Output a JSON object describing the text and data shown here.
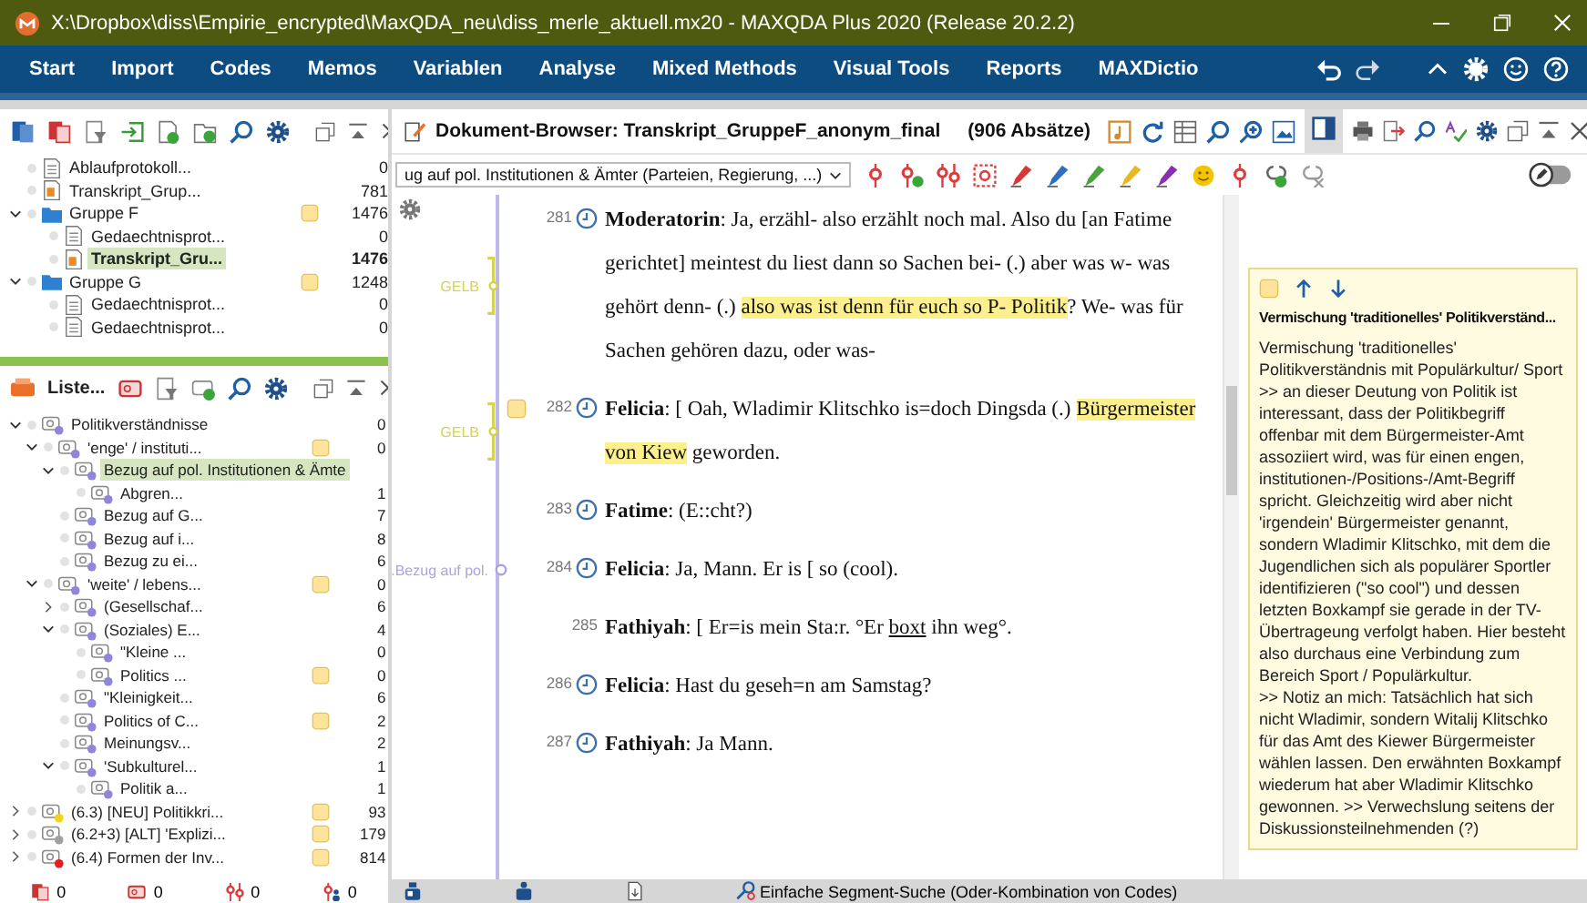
{
  "window": {
    "title": "X:\\Dropbox\\diss\\Empirie_encrypted\\MaxQDA_neu\\diss_merle_aktuell.mx20 - MAXQDA Plus 2020 (Release 20.2.2)"
  },
  "menu": [
    {
      "label": "Start"
    },
    {
      "label": "Import"
    },
    {
      "label": "Codes"
    },
    {
      "label": "Memos"
    },
    {
      "label": "Variablen"
    },
    {
      "label": "Analyse"
    },
    {
      "label": "Mixed Methods"
    },
    {
      "label": "Visual Tools"
    },
    {
      "label": "Reports"
    },
    {
      "label": "MAXDictio"
    }
  ],
  "documents": {
    "items": [
      {
        "kind": "text",
        "label": "Ablaufprotokoll...",
        "count": "0",
        "memo": false,
        "selected": false
      },
      {
        "kind": "transcript",
        "label": "Transkript_Grup...",
        "count": "781",
        "memo": false,
        "selected": false
      },
      {
        "kind": "group",
        "label": "Gruppe F",
        "count": "1476",
        "memo": true,
        "selected": false,
        "expanded": true,
        "children": [
          {
            "kind": "text",
            "label": "Gedaechtnisprot...",
            "count": "0",
            "memo": false,
            "selected": false
          },
          {
            "kind": "transcript",
            "label": "Transkript_Gru...",
            "count": "1476",
            "memo": false,
            "selected": true
          }
        ]
      },
      {
        "kind": "group",
        "label": "Gruppe G",
        "count": "1248",
        "memo": true,
        "selected": false,
        "expanded": true,
        "children": [
          {
            "kind": "text",
            "label": "Gedaechtnisprot...",
            "count": "0",
            "memo": false,
            "selected": false
          },
          {
            "kind": "text",
            "label": "Gedaechtnisprot...",
            "count": "0",
            "memo": false,
            "selected": false
          }
        ]
      }
    ]
  },
  "codes": {
    "title": "Liste...",
    "items": [
      {
        "label": "Politikverständnisse",
        "count": "0",
        "memo": false,
        "color": "#8f86d8",
        "selected": false,
        "expanded": true,
        "children": [
          {
            "label": "'enge' / instituti...",
            "count": "0",
            "memo": true,
            "color": "#8f86d8",
            "selected": false,
            "expanded": true,
            "children": [
              {
                "label": "Bezug auf pol. Institutionen & Ämte",
                "memo": false,
                "color": "#8f86d8",
                "selected": true,
                "expanded": true,
                "children": [
                  {
                    "label": "Abgren...",
                    "count": "1",
                    "memo": false,
                    "color": "#8f86d8",
                    "selected": false
                  }
                ]
              },
              {
                "label": "Bezug auf G...",
                "count": "7",
                "memo": false,
                "color": "#8f86d8",
                "selected": false
              },
              {
                "label": "Bezug auf i...",
                "count": "8",
                "memo": false,
                "color": "#8f86d8",
                "selected": false
              },
              {
                "label": "Bezug zu ei...",
                "count": "6",
                "memo": false,
                "color": "#8f86d8",
                "selected": false
              }
            ]
          },
          {
            "label": "'weite' / lebens...",
            "count": "0",
            "memo": true,
            "color": "#8f86d8",
            "selected": false,
            "expanded": true,
            "children": [
              {
                "label": "(Gesellschaf...",
                "count": "6",
                "memo": false,
                "color": "#8f86d8",
                "selected": false,
                "expanded": false
              },
              {
                "label": "(Soziales) E...",
                "count": "4",
                "memo": false,
                "color": "#8f86d8",
                "selected": false,
                "expanded": true,
                "children": [
                  {
                    "label": "\"Kleine ...",
                    "count": "0",
                    "memo": false,
                    "color": "#8f86d8",
                    "selected": false
                  },
                  {
                    "label": "Politics ...",
                    "count": "0",
                    "memo": true,
                    "color": "#8f86d8",
                    "selected": false
                  }
                ]
              },
              {
                "label": "\"Kleinigkeit...",
                "count": "6",
                "memo": false,
                "color": "#8f86d8",
                "selected": false
              },
              {
                "label": "Politics of C...",
                "count": "2",
                "memo": true,
                "color": "#8f86d8",
                "selected": false
              },
              {
                "label": "Meinungsv...",
                "count": "2",
                "memo": false,
                "color": "#8f86d8",
                "selected": false
              },
              {
                "label": "'Subkulturel...",
                "count": "1",
                "memo": false,
                "color": "#8f86d8",
                "selected": false,
                "expanded": true,
                "children": [
                  {
                    "label": "Politik a...",
                    "count": "1",
                    "memo": false,
                    "color": "#8f86d8",
                    "selected": false
                  }
                ]
              }
            ]
          }
        ]
      },
      {
        "label": "(6.3) [NEU] Politikkri...",
        "count": "93",
        "memo": true,
        "color": "#f2d21b",
        "selected": false,
        "expanded": false
      },
      {
        "label": "(6.2+3) [ALT] 'Explizi...",
        "count": "179",
        "memo": true,
        "color": "#a0a0a0",
        "selected": false,
        "expanded": false
      },
      {
        "label": "(6.4) Formen der Inv...",
        "count": "814",
        "memo": true,
        "color": "#e02020",
        "selected": false,
        "expanded": false
      }
    ]
  },
  "document_browser": {
    "title": "Dokument-Browser: Transkript_GruppeF_anonym_final",
    "paragraph_count": "(906 Absätze)",
    "code_selector": "ug auf pol. Institutionen & Ämter (Parteien, Regierung, ...)",
    "paragraphs": [
      {
        "number": "281",
        "clock": true,
        "memo": false,
        "code_marks": [
          {
            "kind": "bracket",
            "label": "GELB",
            "color": "#d4d44c"
          }
        ],
        "segments": [
          {
            "kind": "speaker",
            "text": "Moderatorin"
          },
          {
            "kind": "plain",
            "text": ": Ja, erzähl- also erzählt noch mal. Also du [an Fatime gerichtet] meintest du liest dann so Sachen bei- (.) aber was w- was gehört denn- (.) "
          },
          {
            "kind": "coded",
            "text": "also was ist denn für euch so P- Politik"
          },
          {
            "kind": "plain",
            "text": "? We- was für Sachen gehören dazu, oder was-"
          }
        ]
      },
      {
        "number": "282",
        "clock": true,
        "memo": true,
        "code_marks": [
          {
            "kind": "bracket",
            "label": "GELB",
            "color": "#d4d44c"
          }
        ],
        "segments": [
          {
            "kind": "speaker",
            "text": "Felicia"
          },
          {
            "kind": "plain",
            "text": ": [ Oah, Wladimir Klitschko is=doch Dingsda (.) "
          },
          {
            "kind": "coded",
            "text": "Bürgermeister von Kiew"
          },
          {
            "kind": "plain",
            "text": " geworden."
          }
        ]
      },
      {
        "number": "283",
        "clock": true,
        "memo": false,
        "segments": [
          {
            "kind": "speaker",
            "text": "Fatime"
          },
          {
            "kind": "plain",
            "text": ": (E::cht?)"
          }
        ]
      },
      {
        "number": "284",
        "clock": true,
        "memo": false,
        "code_marks": [
          {
            "kind": "point",
            "label": ".Bezug auf pol.",
            "color": "#a9a3e0"
          }
        ],
        "segments": [
          {
            "kind": "speaker",
            "text": "Felicia"
          },
          {
            "kind": "plain",
            "text": ": Ja, Mann. Er is [ so (cool)."
          }
        ]
      },
      {
        "number": "285",
        "clock": false,
        "memo": false,
        "segments": [
          {
            "kind": "speaker",
            "text": "Fathiyah"
          },
          {
            "kind": "plain",
            "text": ": [ Er=is mein Sta:r. °Er "
          },
          {
            "kind": "underlined",
            "text": "boxt"
          },
          {
            "kind": "plain",
            "text": " ihn weg°."
          }
        ]
      },
      {
        "number": "286",
        "clock": true,
        "memo": false,
        "segments": [
          {
            "kind": "speaker",
            "text": "Felicia"
          },
          {
            "kind": "plain",
            "text": ": Hast du geseh=n am Samstag?"
          }
        ]
      },
      {
        "number": "287",
        "clock": true,
        "memo": false,
        "segments": [
          {
            "kind": "speaker",
            "text": "Fathiyah"
          },
          {
            "kind": "plain",
            "text": ": Ja Mann."
          }
        ]
      }
    ]
  },
  "memo": {
    "title": "Vermischung 'traditionelles' Politikverständ...",
    "text": "Vermischung 'traditionelles' Politikverständnis mit Populärkultur/ Sport\n>> an dieser Deutung von Politik ist interessant, dass der Politikbegriff offenbar mit dem Bürgermeister-Amt assoziiert wird, was für einen engen, institutionen-/Positions-/Amt-Begriff spricht. Gleichzeitig wird aber nicht 'irgendein' Bürgermeister genannt, sondern Wladimir Klitschko, mit dem die Jugendlichen sich als populärer Sportler identifizieren (\"so cool\") und dessen letzten Boxkampf sie gerade in der TV-Übertrageung verfolgt haben. Hier besteht also durchaus eine Verbindung zum Bereich Sport / Populärkultur.\n>> Notiz an mich: Tatsächlich hat sich nicht Wladimir, sondern Witalij Klitschko für das Amt des Kiewer Bürgermeister wählen lassen. Den erwähnten Boxkampf wiederum hat aber Wladimir Klitschko gewonnen. >> Verwechslung seitens der Diskussionsteilnehmenden (?)"
  },
  "status_bar": {
    "counts": [
      "0",
      "0",
      "0",
      "0"
    ],
    "search_mode": "Einfache Segment-Suche (Oder-Kombination von Codes)"
  }
}
